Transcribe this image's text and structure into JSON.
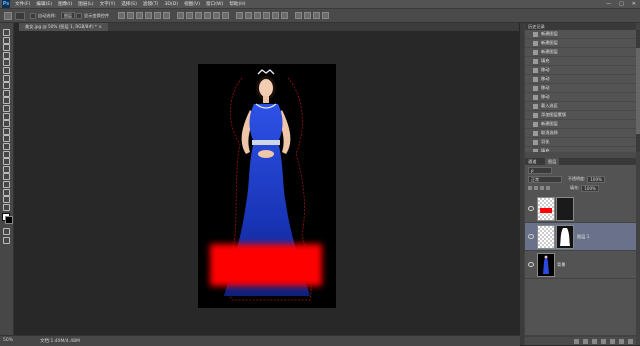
{
  "app": {
    "logo": "Ps"
  },
  "menubar": {
    "items": [
      "文件(F)",
      "编辑(E)",
      "图像(I)",
      "图层(L)",
      "文字(Y)",
      "选择(S)",
      "滤镜(T)",
      "3D(D)",
      "视图(V)",
      "窗口(W)",
      "帮助(H)"
    ],
    "window_controls": [
      "—",
      "□",
      "✕"
    ]
  },
  "options_bar": {
    "mode_label": "自动选择：",
    "mode_value": "图层",
    "show_transform": "显示变换控件"
  },
  "document_tab": {
    "label": "美女.jpg @ 50% (图层 1, RGB/8#) * ×"
  },
  "status_bar": {
    "zoom": "50%",
    "doc_info": "文档:1.40M/4.48M"
  },
  "history_panel": {
    "tabs": [
      "历史记录"
    ],
    "items": [
      "新建图层",
      "新建图层",
      "新建图层",
      "填充",
      "移动",
      "移动",
      "移动",
      "移动",
      "载入选区",
      "添加图层蒙版",
      "新建图层",
      "取消选择",
      "羽化",
      "填充",
      "取消选择"
    ],
    "active_index": 14
  },
  "layers_panel": {
    "tabs": [
      "通道",
      "图层"
    ],
    "blend_mode": "正常",
    "opacity_label": "不透明度:",
    "opacity_value": "100%",
    "fill_label": "填充:",
    "fill_value": "100%",
    "layers": [
      {
        "name": "",
        "selected": false,
        "type": "red"
      },
      {
        "name": "图层 1",
        "selected": true,
        "type": "masked"
      },
      {
        "name": "背景",
        "selected": false,
        "type": "photo"
      }
    ]
  },
  "colors": {
    "red_fill": "#ff0000",
    "dress_blue": "#1c3fd0",
    "selection_red": "#d61a1a"
  }
}
